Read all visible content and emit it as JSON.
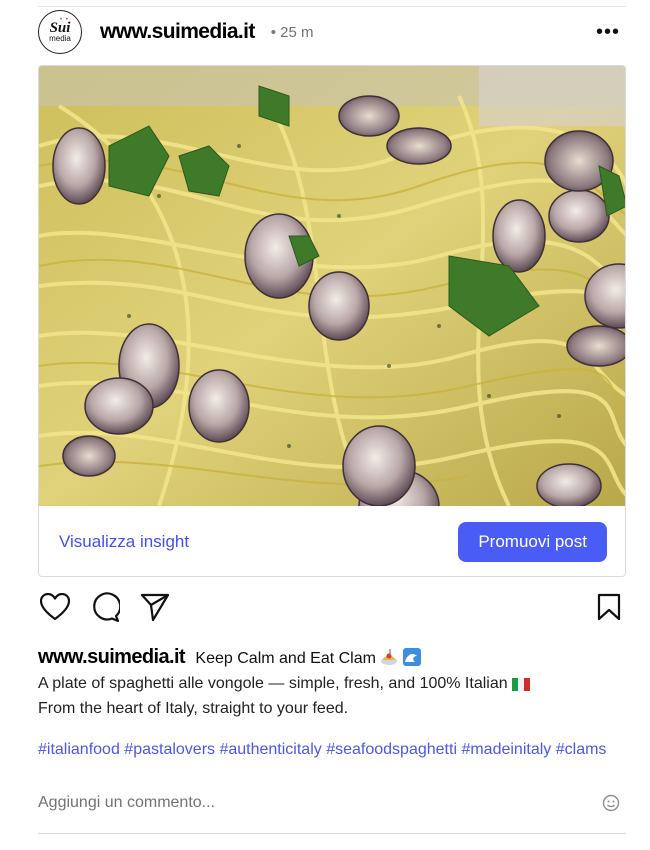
{
  "post": {
    "username": "www.suimedia.it",
    "time": "• 25 m",
    "avatar_logo": "Sui",
    "avatar_sub": "media",
    "more_icon": "more-horizontal-icon"
  },
  "card": {
    "insights_label": "Visualizza insight",
    "promote_label": "Promuovi post"
  },
  "actions": {
    "icons": [
      "heart-icon",
      "comment-icon",
      "share-icon",
      "bookmark-icon"
    ]
  },
  "caption": {
    "username": "www.suimedia.it",
    "title": "Keep Calm and Eat Clam",
    "line1": "A plate of spaghetti alle vongole — simple, fresh, and 100% Italian",
    "line2": "From the heart of Italy, straight to your feed."
  },
  "hashtags": [
    "#italianfood",
    "#pastalovers",
    "#authenticitaly",
    "#seafoodspaghetti",
    "#madeinitaly",
    "#clams"
  ],
  "comment": {
    "placeholder": "Aggiungi un commento..."
  },
  "colors": {
    "link": "#4150f7",
    "button": "#4a5cf6",
    "hashtag": "#4a58e8"
  }
}
